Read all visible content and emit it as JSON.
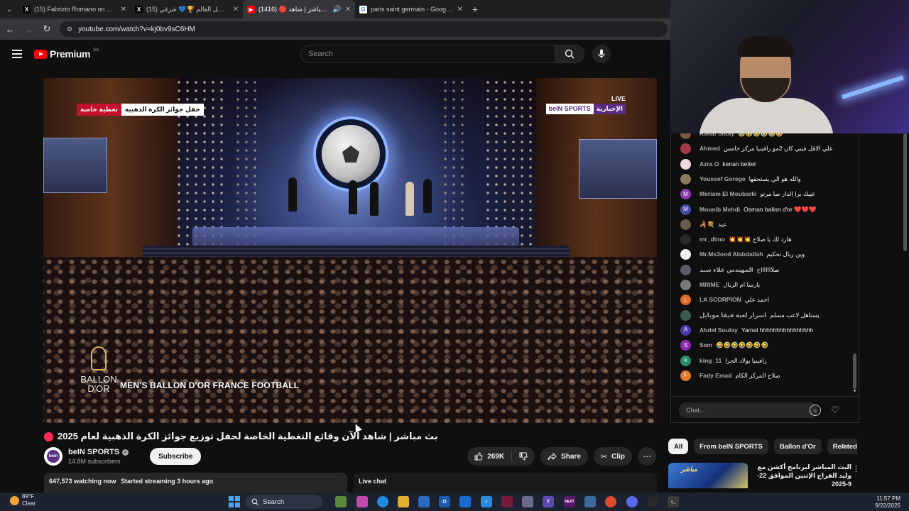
{
  "browser": {
    "tabs": [
      {
        "title": "(15) Fabrizio Romano on X: \"🎙️",
        "favicon": "x-icon"
      },
      {
        "title": "(15) بطل العالم 🏆💙 شرقي (@",
        "favicon": "x-icon"
      },
      {
        "title": "(1416) 🔴 بث مباشر | شاهد",
        "favicon": "youtube-icon",
        "active": true
      },
      {
        "title": "paris saint germain - Google Se",
        "favicon": "google-icon"
      }
    ],
    "url": "youtube.com/watch?v=kj0bv9sC6HM"
  },
  "youtube": {
    "logo_text": "Premium",
    "region": "SA",
    "search_placeholder": "Search"
  },
  "video": {
    "badge_left_red": "تغطية خاصة",
    "badge_left_white": "حفل جوائز الكرة الذهبية",
    "live_label": "LIVE",
    "channel_badge_1": "beIN SPORTS",
    "channel_badge_2": "الإخبارية",
    "lower_banner": "MEN'S BALLON D'OR FRANCE FOOTBALL",
    "logo_line1": "BALLON",
    "logo_line2": "D'OR",
    "title": "بث مباشر | شاهد الآن وقائع التغطية الخاصة لحفل توزيع جوائز الكرة الذهبية لعام 2025"
  },
  "channel": {
    "name": "beIN SPORTS",
    "subscribers": "14.8M subscribers",
    "subscribe_label": "Subscribe"
  },
  "actions": {
    "likes": "269K",
    "share": "Share",
    "clip": "Clip"
  },
  "stats": {
    "watching": "647,573 watching now",
    "started": "Started streaming 3 hours ago",
    "live_chat_label": "Live chat"
  },
  "chat": {
    "messages": [
      {
        "author": "Rahaf Sholy",
        "text": "🤣🤣🤣🤣🤣🤣",
        "avatar_color": "#7b5a3c",
        "initial": ""
      },
      {
        "author": "Ahmed",
        "text": "علي الاقل فيني كان 2مو رافينيا مركز خامس",
        "avatar_color": "#a23a4a",
        "initial": ""
      },
      {
        "author": "Azra O",
        "text": "kenan better",
        "avatar_color": "#f2d8e0",
        "initial": ""
      },
      {
        "author": "Youssef Gorege",
        "text": "والله هو الي يستحقها",
        "avatar_color": "#8a7a5a",
        "initial": ""
      },
      {
        "author": "Meriam El Moubarki",
        "text": "عيبك برا الدار صا مرتو",
        "avatar_color": "#8e3ab0",
        "initial": "M"
      },
      {
        "author": "Mounib Mehdi",
        "text": "Osman ballon d'or ❤️❤️❤️",
        "avatar_color": "#4a4aa8",
        "initial": "M"
      },
      {
        "author": "🦂💐",
        "text": "عيد",
        "avatar_color": "#6a5a4a",
        "initial": ""
      },
      {
        "author": "mr_dimo",
        "text": "💥💥💥 هارد لك يا صلاح",
        "avatar_color": "#2a2a2a",
        "initial": ""
      },
      {
        "author": "Mr.Ms3ood Alabdallah",
        "text": "وين ريال تحكيم",
        "avatar_color": "#f1f1f1",
        "initial": ""
      },
      {
        "author": "المهندس علاء سيد",
        "text": "صلاااااااح",
        "avatar_color": "#5a5a6a",
        "initial": ""
      },
      {
        "author": "MRIME",
        "text": "بارسا ام الزبال",
        "avatar_color": "#7a7a7a",
        "initial": ""
      },
      {
        "author": "LA SCORPION",
        "text": "احمد علي",
        "avatar_color": "#e06a2a",
        "initial": "L"
      },
      {
        "author": "اسرار لعبة فيفا موبايل",
        "text": "يستاهل لاعب مسلم",
        "avatar_color": "#3a5a4a",
        "initial": ""
      },
      {
        "author": "Abdel Soulay",
        "text": "Yamal hhhhhhhhhhhhhhhh",
        "avatar_color": "#4a3ab0",
        "initial": "A"
      },
      {
        "author": "Sam",
        "text": "🤣🤣🤣🤣🤣🤣🤣",
        "avatar_color": "#8e2ab0",
        "initial": "S"
      },
      {
        "author": "king_11",
        "text": "رافينيا يولاد الحرا",
        "avatar_color": "#2a8a6a",
        "initial": "k"
      },
      {
        "author": "Fady Emad",
        "text": "صلاح المركز الكام",
        "avatar_color": "#e07a2a",
        "initial": "F"
      }
    ],
    "input_placeholder": "Chat..."
  },
  "chips": [
    "All",
    "From beIN SPORTS",
    "Ballon d'Or",
    "Related"
  ],
  "related": {
    "thumb_text": "مباشر",
    "title": "البث المباشر لبرنامج أكشن مع وليد الفراج الإثنين الموافق 22-9-2025"
  },
  "taskbar": {
    "temp": "89°F",
    "condition": "Clear",
    "search_label": "Search",
    "time": "11:57 PM",
    "date": "9/22/2025"
  }
}
